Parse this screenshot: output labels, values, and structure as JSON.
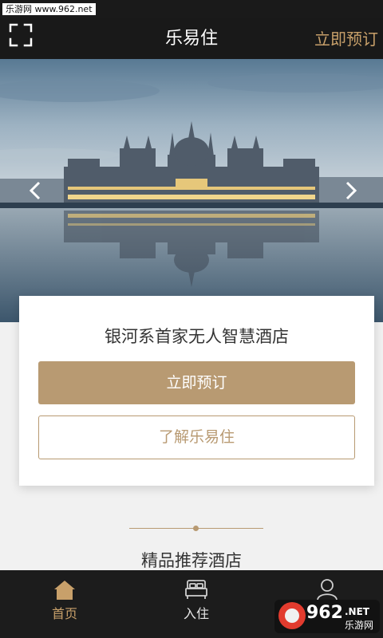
{
  "watermark": {
    "text": "乐游网 www.962.net"
  },
  "header": {
    "title": "乐易住",
    "book_label": "立即预订",
    "scan_icon": "scan-icon"
  },
  "banner": {
    "image": "parliament-building-photo",
    "prev_icon": "chevron-left-icon",
    "next_icon": "chevron-right-icon"
  },
  "card": {
    "title": "银河系首家无人智慧酒店",
    "book_button": "立即预订",
    "learn_button": "了解乐易住"
  },
  "section": {
    "title": "精品推荐酒店"
  },
  "tabs": [
    {
      "label": "首页",
      "icon": "home-icon",
      "active": true
    },
    {
      "label": "入住",
      "icon": "bed-icon",
      "active": false
    },
    {
      "label": "",
      "icon": "user-icon",
      "active": false
    }
  ],
  "logo": {
    "text": "962.NET",
    "subtext": "乐游网"
  },
  "colors": {
    "accent": "#b89a72",
    "header_bg": "#191919",
    "tabbar_bg": "#1c1c1c",
    "active_tab": "#c8a06a"
  }
}
